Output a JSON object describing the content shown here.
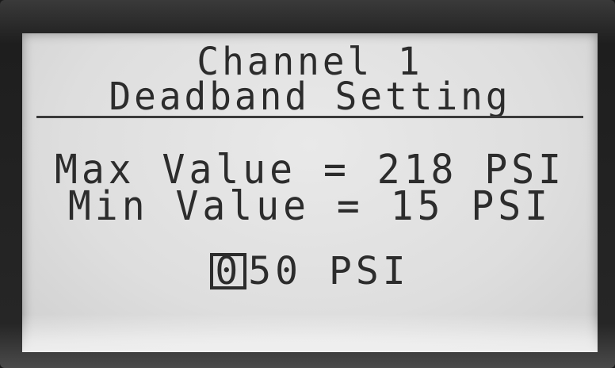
{
  "screen": {
    "title_line1": "Channel 1",
    "title_line2": "Deadband Setting",
    "max_line": "Max Value = 218 PSI",
    "min_line": "Min Value = 15 PSI",
    "edit_cursor_digit": "0",
    "edit_rest": "50 PSI"
  },
  "colors": {
    "lcd_background": "#e0e0e0",
    "lcd_text": "#2c2c2c",
    "bezel": "#222222"
  }
}
